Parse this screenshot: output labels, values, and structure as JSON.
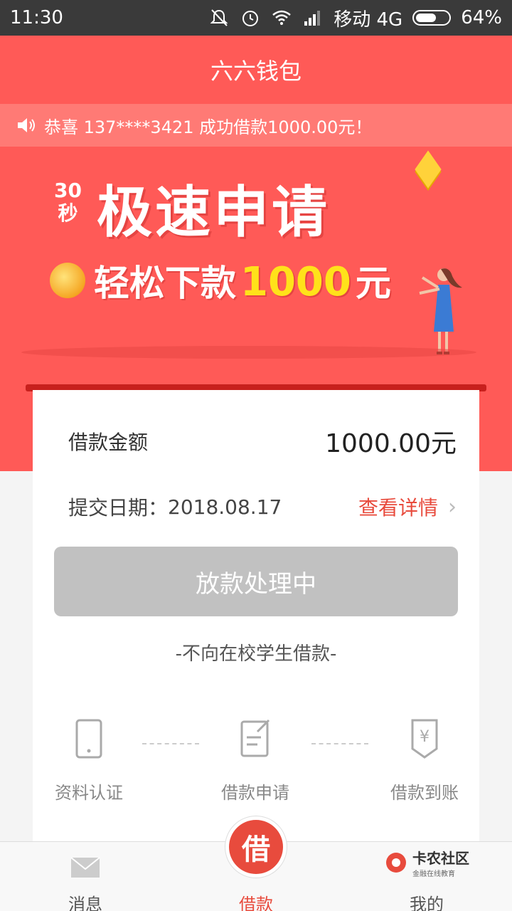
{
  "status_bar": {
    "time": "11:30",
    "carrier": "移动 4G",
    "battery": "64%",
    "battery_level": 0.64
  },
  "header": {
    "title": "六六钱包"
  },
  "notice": {
    "text": "恭喜 137****3421 成功借款1000.00元！"
  },
  "banner": {
    "seconds_top": "30",
    "seconds_bottom": "秒",
    "title": "极速申请",
    "sub_prefix": "轻松下款",
    "sub_amount": "1000",
    "sub_suffix": "元"
  },
  "loan": {
    "amount_label": "借款金额",
    "amount_value": "1000.00元",
    "date_label": "提交日期：",
    "date_value": "2018.08.17",
    "detail_link": "查看详情",
    "status_button": "放款处理中",
    "note": "-不向在校学生借款-"
  },
  "steps": [
    {
      "label": "资料认证",
      "icon": "phone-icon"
    },
    {
      "label": "借款申请",
      "icon": "form-edit-icon"
    },
    {
      "label": "借款到账",
      "icon": "yen-receipt-icon"
    }
  ],
  "tabbar": {
    "messages": "消息",
    "loan": "借款",
    "loan_badge": "借",
    "mine": "我的"
  },
  "watermark": {
    "name": "卡农社区",
    "sub": "金融在线教育"
  },
  "colors": {
    "brand_red": "#ff5a57",
    "accent": "#e84b3d",
    "button_disabled": "#c1c1c1",
    "highlight": "#ffe21a"
  }
}
